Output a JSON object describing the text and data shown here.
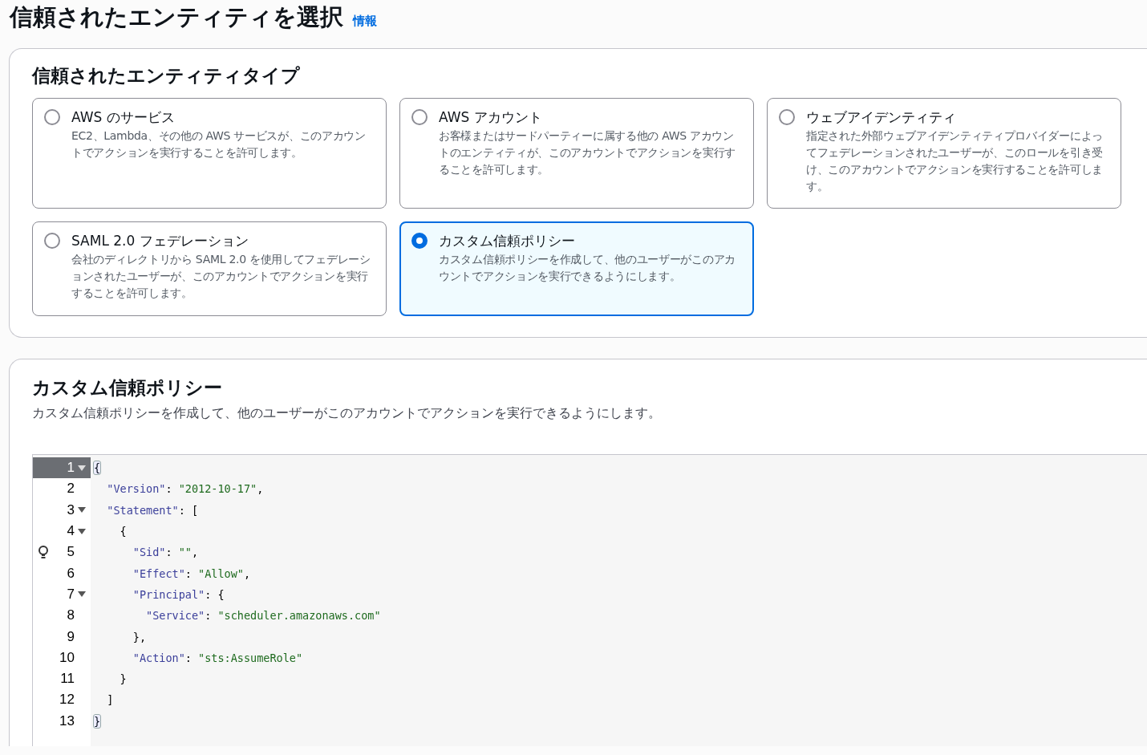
{
  "page": {
    "title": "信頼されたエンティティを選択",
    "info_link": "情報"
  },
  "entity_type": {
    "heading": "信頼されたエンティティタイプ",
    "options": [
      {
        "label": "AWS のサービス",
        "description": "EC2、Lambda、その他の AWS サービスが、このアカウントでアクションを実行することを許可します。",
        "selected": false
      },
      {
        "label": "AWS アカウント",
        "description": "お客様またはサードパーティーに属する他の AWS アカウントのエンティティが、このアカウントでアクションを実行することを許可します。",
        "selected": false
      },
      {
        "label": "ウェブアイデンティティ",
        "description": "指定された外部ウェブアイデンティティプロバイダーによってフェデレーションされたユーザーが、このロールを引き受け、このアカウントでアクションを実行することを許可します。",
        "selected": false
      },
      {
        "label": "SAML 2.0 フェデレーション",
        "description": "会社のディレクトリから SAML 2.0 を使用してフェデレーションされたユーザーが、このアカウントでアクションを実行することを許可します。",
        "selected": false
      },
      {
        "label": "カスタム信頼ポリシー",
        "description": "カスタム信頼ポリシーを作成して、他のユーザーがこのアカウントでアクションを実行できるようにします。",
        "selected": true
      }
    ]
  },
  "custom_policy": {
    "heading": "カスタム信頼ポリシー",
    "description": "カスタム信頼ポリシーを作成して、他のユーザーがこのアカウントでアクションを実行できるようにします。",
    "editor": {
      "lines": [
        {
          "number": "1",
          "active": true,
          "foldable": true,
          "hint": false,
          "tokens": [
            {
              "kind": "bracket-match",
              "text": "{"
            }
          ]
        },
        {
          "number": "2",
          "active": false,
          "foldable": false,
          "hint": false,
          "tokens": [
            {
              "kind": "key",
              "text": "  \"Version\""
            },
            {
              "kind": "punct",
              "text": ": "
            },
            {
              "kind": "string",
              "text": "\"2012-10-17\""
            },
            {
              "kind": "punct",
              "text": ","
            }
          ]
        },
        {
          "number": "3",
          "active": false,
          "foldable": true,
          "hint": false,
          "tokens": [
            {
              "kind": "key",
              "text": "  \"Statement\""
            },
            {
              "kind": "punct",
              "text": ": ["
            }
          ]
        },
        {
          "number": "4",
          "active": false,
          "foldable": true,
          "hint": false,
          "tokens": [
            {
              "kind": "punct",
              "text": "    {"
            }
          ]
        },
        {
          "number": "5",
          "active": false,
          "foldable": false,
          "hint": true,
          "tokens": [
            {
              "kind": "key",
              "text": "      \"Sid\""
            },
            {
              "kind": "punct",
              "text": ": "
            },
            {
              "kind": "string",
              "text": "\"\""
            },
            {
              "kind": "punct",
              "text": ","
            }
          ]
        },
        {
          "number": "6",
          "active": false,
          "foldable": false,
          "hint": false,
          "tokens": [
            {
              "kind": "key",
              "text": "      \"Effect\""
            },
            {
              "kind": "punct",
              "text": ": "
            },
            {
              "kind": "string",
              "text": "\"Allow\""
            },
            {
              "kind": "punct",
              "text": ","
            }
          ]
        },
        {
          "number": "7",
          "active": false,
          "foldable": true,
          "hint": false,
          "tokens": [
            {
              "kind": "key",
              "text": "      \"Principal\""
            },
            {
              "kind": "punct",
              "text": ": {"
            }
          ]
        },
        {
          "number": "8",
          "active": false,
          "foldable": false,
          "hint": false,
          "tokens": [
            {
              "kind": "key",
              "text": "        \"Service\""
            },
            {
              "kind": "punct",
              "text": ": "
            },
            {
              "kind": "string",
              "text": "\"scheduler.amazonaws.com\""
            }
          ]
        },
        {
          "number": "9",
          "active": false,
          "foldable": false,
          "hint": false,
          "tokens": [
            {
              "kind": "punct",
              "text": "      },"
            }
          ]
        },
        {
          "number": "10",
          "active": false,
          "foldable": false,
          "hint": false,
          "tokens": [
            {
              "kind": "key",
              "text": "      \"Action\""
            },
            {
              "kind": "punct",
              "text": ": "
            },
            {
              "kind": "string",
              "text": "\"sts:AssumeRole\""
            }
          ]
        },
        {
          "number": "11",
          "active": false,
          "foldable": false,
          "hint": false,
          "tokens": [
            {
              "kind": "punct",
              "text": "    }"
            }
          ]
        },
        {
          "number": "12",
          "active": false,
          "foldable": false,
          "hint": false,
          "tokens": [
            {
              "kind": "punct",
              "text": "  ]"
            }
          ]
        },
        {
          "number": "13",
          "active": false,
          "foldable": false,
          "hint": false,
          "tokens": [
            {
              "kind": "bracket-match",
              "text": "}"
            }
          ]
        }
      ]
    }
  }
}
